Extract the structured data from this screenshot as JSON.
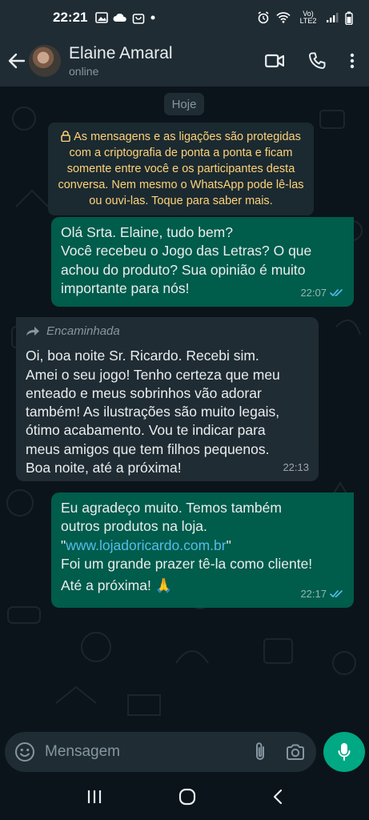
{
  "status_bar": {
    "time": "22:21",
    "network_label": "Vo) LTE2"
  },
  "header": {
    "contact_name": "Elaine Amaral",
    "contact_status": "online"
  },
  "chat": {
    "date_chip": "Hoje",
    "encryption_notice": [
      "As mensagens e as ligações são protegidas",
      "com a criptografia de ponta a ponta e ficam",
      "somente entre você e os participantes desta",
      "conversa. Nem mesmo o WhatsApp pode lê-las",
      "ou ouvi-las. Toque para saber mais."
    ],
    "messages": [
      {
        "lines": [
          "Olá Srta. Elaine, tudo bem?",
          "Você recebeu o Jogo das Letras? O que",
          "achou do produto? Sua opinião é muito",
          "importante para nós!"
        ],
        "time": "22:07"
      },
      {
        "forwarded_label": "Encaminhada",
        "lines": [
          "Oi, boa noite Sr. Ricardo. Recebi sim.",
          "Amei o seu jogo! Tenho certeza que meu",
          "enteado e meus sobrinhos vão adorar",
          "também! As ilustrações são muito legais,",
          "ótimo acabamento. Vou te indicar para",
          "meus amigos que tem filhos pequenos.",
          "Boa noite, até a próxima!"
        ],
        "time": "22:13"
      },
      {
        "line1": "Eu agradeço muito. Temos também",
        "line2": "outros produtos na loja.",
        "quote_open": "\"",
        "link": "www.lojadoricardo.com.br",
        "quote_close": "\"",
        "line4": "Foi um grande prazer tê-la como cliente!",
        "line5": "Até a próxima! 🙏",
        "time": "22:17"
      }
    ]
  },
  "input": {
    "placeholder": "Mensagem"
  },
  "colors": {
    "background": "#0b141a",
    "bar": "#1f2c34",
    "outgoing_bubble": "#005c4b",
    "incoming_bubble": "#202c33",
    "accent": "#00a884",
    "link": "#53bdeb",
    "read_ticks": "#53bdeb",
    "notice_text": "#ffd279"
  },
  "icons": [
    "back-arrow-icon",
    "video-call-icon",
    "phone-icon",
    "more-vert-icon",
    "lock-icon",
    "forward-icon",
    "double-check-icon",
    "emoji-icon",
    "attach-icon",
    "camera-icon",
    "mic-icon",
    "nav-recents-icon",
    "nav-home-icon",
    "nav-back-icon"
  ]
}
